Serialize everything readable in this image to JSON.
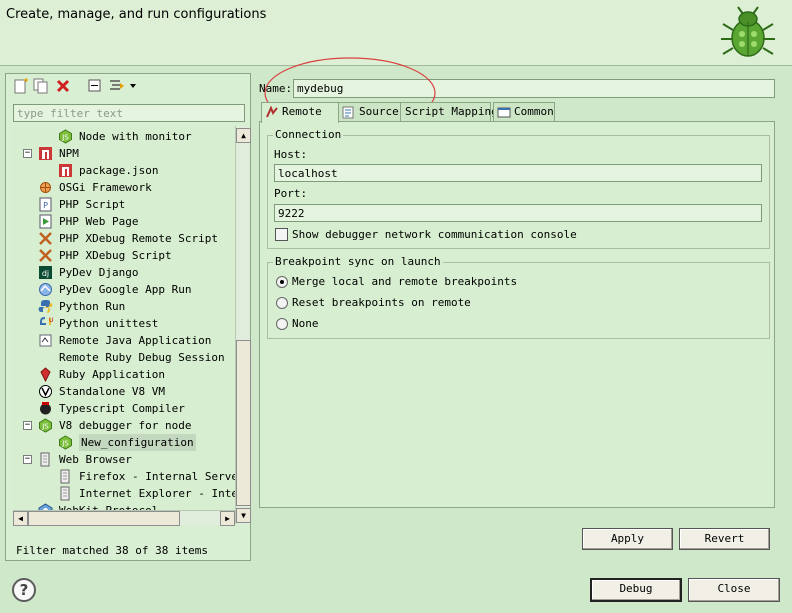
{
  "header": {
    "title": "Create, manage, and run configurations"
  },
  "left": {
    "toolbar": [
      {
        "name": "new-launch-config-icon"
      },
      {
        "name": "duplicate-icon"
      },
      {
        "name": "delete-icon"
      },
      {
        "name": "collapse-all-icon"
      },
      {
        "name": "filter-menu-icon"
      },
      {
        "name": "chevron-down-icon"
      }
    ],
    "filter_placeholder": "type filter text",
    "tree": [
      {
        "label": "Node with monitor",
        "level": 1,
        "icon": "nodejs-icon"
      },
      {
        "label": "NPM",
        "level": 0,
        "icon": "npm-icon",
        "expanded": true
      },
      {
        "label": "package.json",
        "level": 1,
        "icon": "npm-icon"
      },
      {
        "label": "OSGi Framework",
        "level": 0,
        "icon": "osgi-icon"
      },
      {
        "label": "PHP Script",
        "level": 0,
        "icon": "php-script-icon"
      },
      {
        "label": "PHP Web Page",
        "level": 0,
        "icon": "php-web-page-icon"
      },
      {
        "label": "PHP XDebug Remote Script",
        "level": 0,
        "icon": "xdebug-icon"
      },
      {
        "label": "PHP XDebug Script",
        "level": 0,
        "icon": "xdebug-icon"
      },
      {
        "label": "PyDev Django",
        "level": 0,
        "icon": "django-icon"
      },
      {
        "label": "PyDev Google App Run",
        "level": 0,
        "icon": "google-app-icon"
      },
      {
        "label": "Python Run",
        "level": 0,
        "icon": "python-icon"
      },
      {
        "label": "Python unittest",
        "level": 0,
        "icon": "python-unittest-icon"
      },
      {
        "label": "Remote Java Application",
        "level": 0,
        "icon": "remote-java-icon"
      },
      {
        "label": "Remote Ruby Debug Session",
        "level": 0,
        "icon": ""
      },
      {
        "label": "Ruby Application",
        "level": 0,
        "icon": "ruby-icon"
      },
      {
        "label": "Standalone V8 VM",
        "level": 0,
        "icon": "v8-icon"
      },
      {
        "label": "Typescript Compiler",
        "level": 0,
        "icon": "typescript-icon"
      },
      {
        "label": "V8 debugger for node",
        "level": 0,
        "icon": "nodejs-icon",
        "expanded": true
      },
      {
        "label": "New_configuration",
        "level": 1,
        "icon": "nodejs-icon",
        "selected": true
      },
      {
        "label": "Web Browser",
        "level": 0,
        "icon": "web-browser-icon",
        "expanded": true
      },
      {
        "label": "Firefox - Internal Server",
        "level": 1,
        "icon": "web-browser-icon"
      },
      {
        "label": "Internet Explorer - Intern",
        "level": 1,
        "icon": "web-browser-icon"
      },
      {
        "label": "WebKit Protocol",
        "level": 0,
        "icon": "webkit-icon"
      }
    ],
    "status": "Filter matched 38 of 38 items"
  },
  "right": {
    "name_label": "Name:",
    "name_value": "mydebug",
    "tabs": [
      {
        "label": "Remote",
        "icon": "remote-icon",
        "active": true
      },
      {
        "label": "Source",
        "icon": "source-icon"
      },
      {
        "label": "Script Mapping",
        "icon": ""
      },
      {
        "label": "Common",
        "icon": "common-icon"
      }
    ],
    "connection": {
      "title": "Connection",
      "host_label": "Host:",
      "host_value": "localhost",
      "port_label": "Port:",
      "port_value": "9222",
      "show_console_label": "Show debugger network communication console",
      "show_console_checked": false
    },
    "breakpoint_sync": {
      "title": "Breakpoint sync on launch",
      "options": [
        {
          "label": "Merge local and remote breakpoints",
          "selected": true
        },
        {
          "label": "Reset breakpoints on remote",
          "selected": false
        },
        {
          "label": "None",
          "selected": false
        }
      ]
    },
    "apply_label": "Apply",
    "revert_label": "Revert"
  },
  "footer": {
    "debug_label": "Debug",
    "close_label": "Close"
  },
  "colors": {
    "background": "#cfe8c9",
    "annotation": "#d94040"
  }
}
